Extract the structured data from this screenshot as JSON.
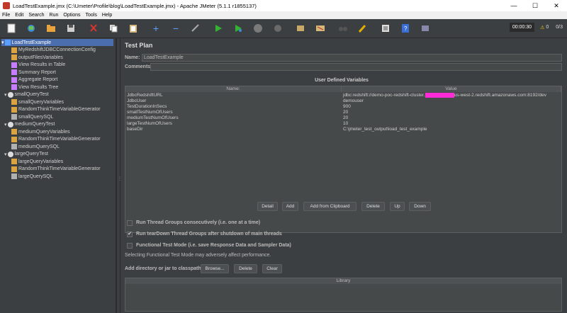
{
  "window": {
    "title": "LoadTestExample.jmx (C:\\Umeter\\Profile\\blog\\LoadTestExample.jmx) - Apache JMeter (5.1.1 r1855137)"
  },
  "menu": [
    "File",
    "Edit",
    "Search",
    "Run",
    "Options",
    "Tools",
    "Help"
  ],
  "toolbar": {
    "timer": "00:00:30",
    "warnings": "0",
    "threads": "0/3"
  },
  "tree": [
    {
      "label": "LoadTestExample",
      "icon": "test-plan-icon"
    },
    {
      "label": "MyRedshiftJDBCConnectionConfig",
      "icon": "config-icon"
    },
    {
      "label": "outputFilesVariables",
      "icon": "config-icon"
    },
    {
      "label": "View Results in Table",
      "icon": "listener-icon"
    },
    {
      "label": "Summary Report",
      "icon": "listener-icon"
    },
    {
      "label": "Aggregate Report",
      "icon": "listener-icon"
    },
    {
      "label": "View Results Tree",
      "icon": "listener-icon"
    },
    {
      "label": "smallQueryTest",
      "icon": "thread-group-icon"
    },
    {
      "label": "smallQueryVariables",
      "icon": "config-icon"
    },
    {
      "label": "RandomThinkTimeVariableGenerator",
      "icon": "config-icon"
    },
    {
      "label": "smallQuerySQL",
      "icon": "sampler-icon"
    },
    {
      "label": "mediumQueryTest",
      "icon": "thread-group-icon"
    },
    {
      "label": "mediumQueryVariables",
      "icon": "config-icon"
    },
    {
      "label": "RandomThinkTimeVariableGenerator",
      "icon": "config-icon"
    },
    {
      "label": "mediumQuerySQL",
      "icon": "sampler-icon"
    },
    {
      "label": "largeQueryTest",
      "icon": "thread-group-icon"
    },
    {
      "label": "largeQueryVariables",
      "icon": "config-icon"
    },
    {
      "label": "RandomThinkTimeVariableGenerator",
      "icon": "config-icon"
    },
    {
      "label": "largeQuerySQL",
      "icon": "sampler-icon"
    }
  ],
  "panel": {
    "title": "Test Plan",
    "name_label": "Name:",
    "name_value": "LoadTestExample",
    "comments_label": "Comments:",
    "udv_title": "User Defined Variables",
    "col_name": "Name:",
    "col_value": "Value",
    "rows": [
      {
        "name": "JdbcRedshiftURL",
        "value_pre": "jdbc:redshift://demo-poc-redshift-cluster.",
        "value_post": "us-west-2.redshift.amazonaws.com:8192/dev"
      },
      {
        "name": "JdbcUser",
        "value": "demouser"
      },
      {
        "name": "TestDurationInSecs",
        "value": "900"
      },
      {
        "name": "smallTestNumOfUsers",
        "value": "20"
      },
      {
        "name": "mediumTestNumOfUsers",
        "value": "20"
      },
      {
        "name": "largeTestNumOfUsers",
        "value": "10"
      },
      {
        "name": "baseDir",
        "value": "C:\\jmeter_test_output\\load_test_example"
      }
    ],
    "buttons": [
      "Detail",
      "Add",
      "Add from Clipboard",
      "Delete",
      "Up",
      "Down"
    ],
    "checks": [
      {
        "label": "Run Thread Groups consecutively (i.e. one at a time)",
        "checked": false
      },
      {
        "label": "Run tearDown Thread Groups after shutdown of main threads",
        "checked": true
      },
      {
        "label": "Functional Test Mode (i.e. save Response Data and Sampler Data)",
        "checked": false
      }
    ],
    "functional_note": "Selecting Functional Test Mode may adversely affect performance.",
    "classpath_label": "Add directory or jar to classpath",
    "classpath_buttons": [
      "Browse...",
      "Delete",
      "Clear"
    ],
    "library_header": "Library"
  }
}
